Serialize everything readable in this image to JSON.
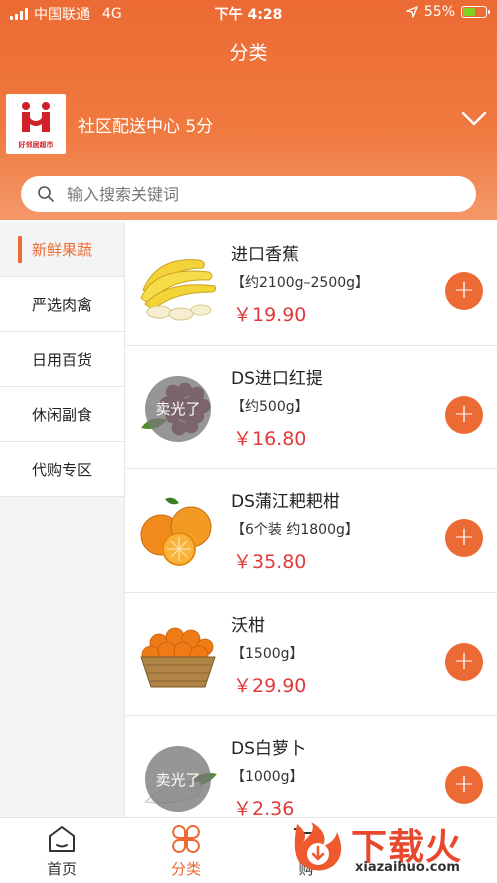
{
  "status_bar": {
    "carrier": "中国联通",
    "network": "4G",
    "time": "下午 4:28",
    "battery": "55%"
  },
  "header": {
    "title": "分类",
    "store": {
      "name": "社区配送中心 5分",
      "logo_text": "好邻居超市",
      "logo_subtext": "GOOD NEIGHBOR SUPERMARKET"
    }
  },
  "search": {
    "placeholder": "输入搜索关键词",
    "value": ""
  },
  "categories": [
    {
      "label": "新鲜果蔬",
      "active": true
    },
    {
      "label": "严选肉禽",
      "active": false
    },
    {
      "label": "日用百货",
      "active": false
    },
    {
      "label": "休闲副食",
      "active": false
    },
    {
      "label": "代购专区",
      "active": false
    }
  ],
  "products": [
    {
      "name": "进口香蕉",
      "spec": "【约2100g–2500g】",
      "price": "￥19.90",
      "sold_out": "",
      "image": "banana"
    },
    {
      "name": "DS进口红提",
      "spec": "【约500g】",
      "price": "￥16.80",
      "sold_out": "卖光了",
      "image": "red-grapes"
    },
    {
      "name": "DS蒲江耙耙柑",
      "spec": "【6个装 约1800g】",
      "price": "￥35.80",
      "sold_out": "",
      "image": "orange"
    },
    {
      "name": "沃柑",
      "spec": "【1500g】",
      "price": "￥29.90",
      "sold_out": "",
      "image": "mandarin-basket"
    },
    {
      "name": "DS白萝卜",
      "spec": "【1000g】",
      "price": "￥2.36",
      "sold_out": "卖光了",
      "image": "white-radish"
    }
  ],
  "tabbar": {
    "home": "首页",
    "category": "分类",
    "cart": "购"
  },
  "watermark": {
    "text": "下载火",
    "url": "xiazaihuo.com"
  },
  "colors": {
    "accent": "#ec6a34",
    "price": "#e03a3a"
  }
}
